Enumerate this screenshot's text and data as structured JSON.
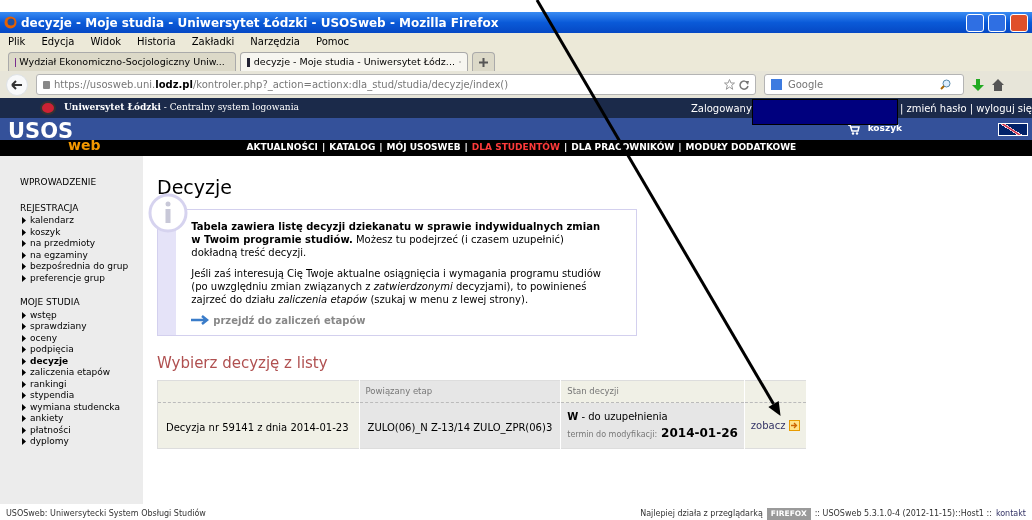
{
  "window": {
    "title": "decyzje - Moje studia - Uniwersytet Łódzki - USOSweb - Mozilla Firefox"
  },
  "menu": [
    "Plik",
    "Edycja",
    "Widok",
    "Historia",
    "Zakładki",
    "Narzędzia",
    "Pomoc"
  ],
  "tabs": [
    {
      "label": "Wydział Ekonomiczno-Socjologiczny Uniw...",
      "selected": false
    },
    {
      "label": "decyzje - Moje studia - Uniwersytet Łódz...",
      "selected": true
    }
  ],
  "address_bar": {
    "url_prefix": "https://usosweb.uni.",
    "url_domain": "lodz.pl",
    "url_rest": "/kontroler.php?_action=actionx:dla_stud/studia/decyzje/index()"
  },
  "search": {
    "placeholder": "Google"
  },
  "site": {
    "university": "Uniwersytet Łódzki",
    "subtitle": "- Centralny system logowania",
    "logged_in": "Zalogowany",
    "account_links": [
      "| zmień hasło | wyloguj się"
    ],
    "logo_top": "USOS",
    "logo_bottom": "web",
    "cart": "koszyk",
    "nav_separator": "|",
    "nav": [
      {
        "label": "AKTUALNOŚCI",
        "selected": false
      },
      {
        "label": "KATALOG",
        "selected": false
      },
      {
        "label": "MÓJ USOSWEB",
        "selected": false
      },
      {
        "label": "DLA STUDENTÓW",
        "selected": true
      },
      {
        "label": "DLA PRACOWNIKÓW",
        "selected": false
      },
      {
        "label": "MODUŁY DODATKOWE",
        "selected": false
      }
    ]
  },
  "sidebar": [
    {
      "title": "WPROWADZENIE"
    },
    {
      "title": "REJESTRACJA",
      "items": [
        {
          "label": "kalendarz",
          "selected": false
        },
        {
          "label": "koszyk",
          "selected": false
        },
        {
          "label": "na przedmioty",
          "selected": false
        },
        {
          "label": "na egzaminy",
          "selected": false
        },
        {
          "label": "bezpośrednia do grup",
          "selected": false
        },
        {
          "label": "preferencje grup",
          "selected": false
        }
      ]
    },
    {
      "title": "MOJE STUDIA",
      "items": [
        {
          "label": "wstęp",
          "selected": false
        },
        {
          "label": "sprawdziany",
          "selected": false
        },
        {
          "label": "oceny",
          "selected": false
        },
        {
          "label": "podpięcia",
          "selected": false
        },
        {
          "label": "decyzje",
          "selected": true
        },
        {
          "label": "zaliczenia etapów",
          "selected": false
        },
        {
          "label": "rankingi",
          "selected": false
        },
        {
          "label": "stypendia",
          "selected": false
        },
        {
          "label": "wymiana studencka",
          "selected": false
        },
        {
          "label": "ankiety",
          "selected": false
        },
        {
          "label": "płatności",
          "selected": false
        },
        {
          "label": "dyplomy",
          "selected": false
        }
      ]
    }
  ],
  "page_title": "Decyzje",
  "info": {
    "paragraphs": [
      "**Tabela zawiera listę decyzji dziekanatu w sprawie indywidualnych zmian w Twoim programie studiów.** Możesz tu podejrzeć (i czasem uzupełnić) dokładną treść decyzji.",
      "Jeśli zaś interesują Cię Twoje aktualne osiągnięcia i wymagania programu studiów (po uwzględniu zmian związanych z *zatwierdzonymi* decyzjami), to powinieneś zajrzeć do działu *zaliczenia etapów* (szukaj w menu z lewej strony)."
    ],
    "link": "przejdź do zaliczeń etapów"
  },
  "section_title": "Wybierz decyzję z listy",
  "table": {
    "columns": [
      "Powiązany etap",
      "Stan decyzji"
    ],
    "rows": [
      {
        "decision": "Decyzja nr 59141 z dnia 2014-01-23",
        "stage": "ZULO(06)_N Z-13/14 ZULO_ZPR(06)3",
        "status_code": "W",
        "status_text": "- do uzupełnienia",
        "deadline_label": "termin do modyfikacji:",
        "deadline": "2014-01-26",
        "action": "zobacz"
      }
    ]
  },
  "footer": {
    "left": "USOSweb: Uniwersytecki System Obsługi Studiów",
    "best_with": "Najlepiej działa z przeglądarką",
    "browser_badge": "FIREFOX",
    "version": ":: USOSweb 5.3.1.0-4 (2012-11-15)::Host1 ::",
    "contact": "kontakt"
  }
}
